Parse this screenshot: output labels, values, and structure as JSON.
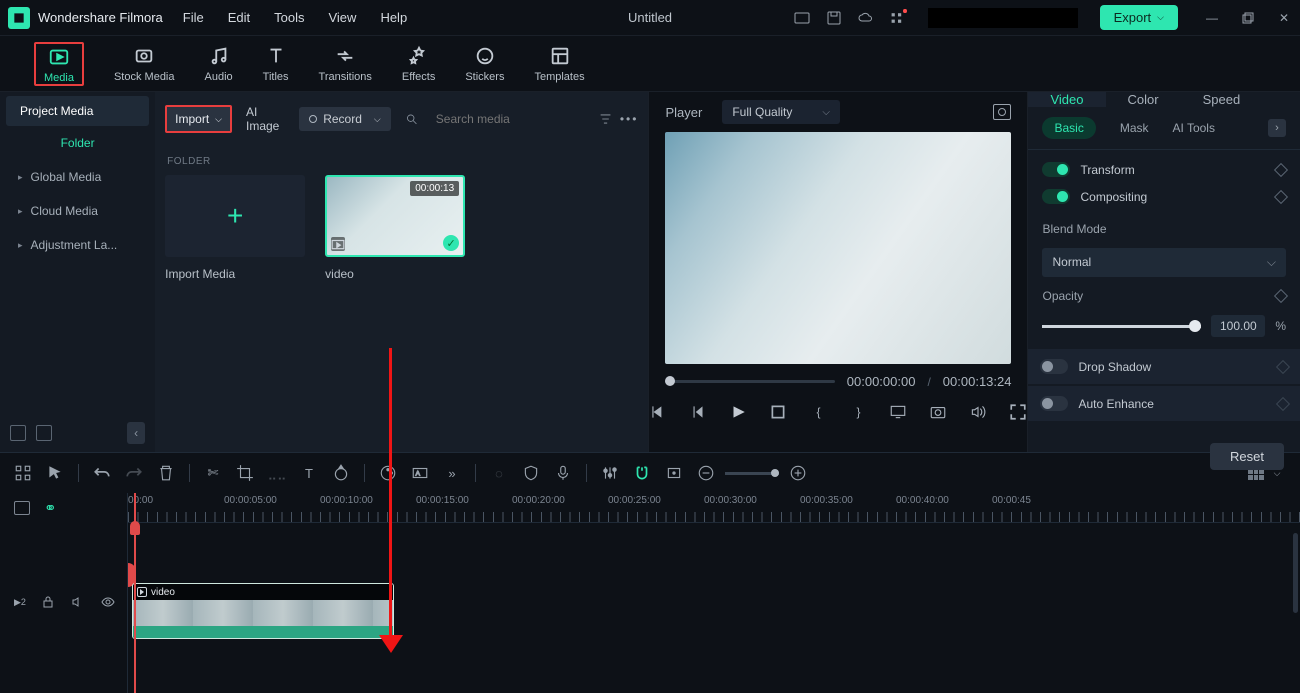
{
  "app_title": "Wondershare Filmora",
  "doc_title": "Untitled",
  "menu": [
    "File",
    "Edit",
    "Tools",
    "View",
    "Help"
  ],
  "export_label": "Export",
  "main_tabs": [
    "Media",
    "Stock Media",
    "Audio",
    "Titles",
    "Transitions",
    "Effects",
    "Stickers",
    "Templates"
  ],
  "sidebar": {
    "project_media": "Project Media",
    "folder_label": "Folder",
    "items": [
      "Global Media",
      "Cloud Media",
      "Adjustment La..."
    ]
  },
  "media_panel": {
    "import_label": "Import",
    "ai_image_label": "AI Image",
    "record_label": "Record",
    "search_placeholder": "Search media",
    "folder_section": "FOLDER",
    "import_media_label": "Import Media",
    "video_thumb": {
      "duration": "00:00:13",
      "label": "video"
    }
  },
  "preview": {
    "player_label": "Player",
    "quality": "Full Quality",
    "current_time": "00:00:00:00",
    "total_time": "00:00:13:24"
  },
  "right": {
    "tabs": [
      "Video",
      "Color",
      "Speed"
    ],
    "subtabs": [
      "Basic",
      "Mask",
      "AI Tools"
    ],
    "transform_label": "Transform",
    "compositing_label": "Compositing",
    "blend_mode_label": "Blend Mode",
    "blend_mode_value": "Normal",
    "opacity_label": "Opacity",
    "opacity_value": "100.00",
    "drop_shadow_label": "Drop Shadow",
    "auto_enhance_label": "Auto Enhance",
    "reset_label": "Reset"
  },
  "timeline": {
    "ruler": [
      "00:00",
      "00:00:05:00",
      "00:00:10:00",
      "00:00:15:00",
      "00:00:20:00",
      "00:00:25:00",
      "00:00:30:00",
      "00:00:35:00",
      "00:00:40:00",
      "00:00:45"
    ],
    "clip_name": "video",
    "track_badge": "2"
  }
}
